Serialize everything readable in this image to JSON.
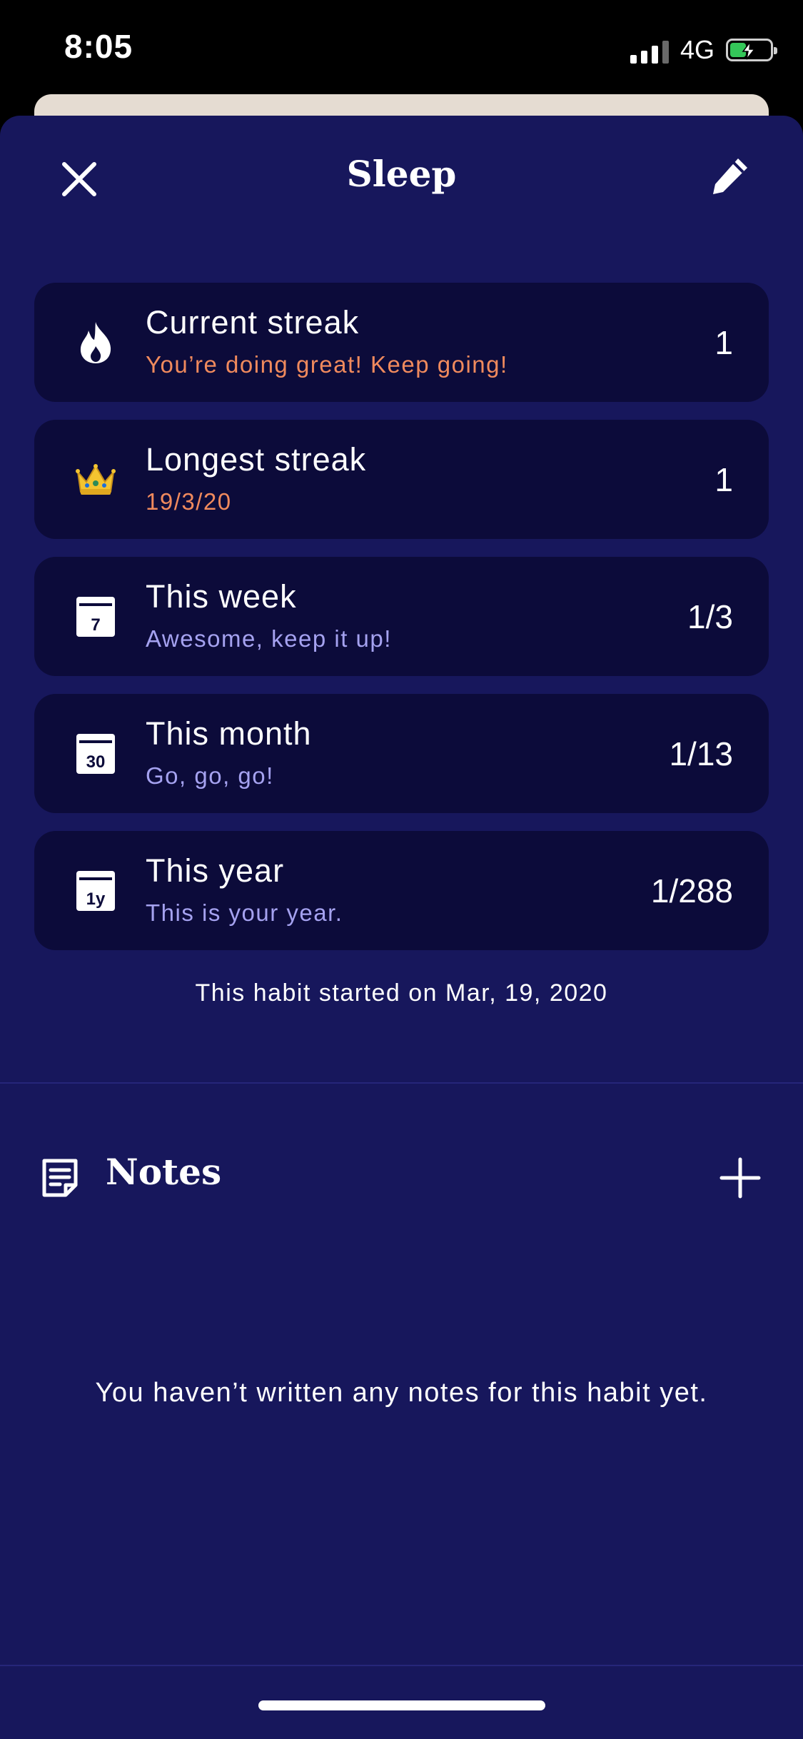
{
  "status_bar": {
    "time": "8:05",
    "network": "4G",
    "battery_color": "#34c759"
  },
  "header": {
    "title": "Sleep",
    "close_icon": "close-icon",
    "edit_icon": "pencil-icon"
  },
  "stats": [
    {
      "icon": "flame-icon",
      "title": "Current streak",
      "subtitle": "You’re doing great! Keep going!",
      "value": "1",
      "subtitle_color": "#f08a5d"
    },
    {
      "icon": "crown-icon",
      "title": "Longest streak",
      "subtitle": "19/3/20",
      "value": "1",
      "subtitle_color": "#f08a5d"
    },
    {
      "icon": "calendar-7-icon",
      "title": "This week",
      "subtitle": "Awesome, keep it up!",
      "value": "1/3",
      "subtitle_color": "#a5a2f0",
      "icon_text": "7"
    },
    {
      "icon": "calendar-30-icon",
      "title": "This month",
      "subtitle": "Go, go, go!",
      "value": "1/13",
      "subtitle_color": "#a5a2f0",
      "icon_text": "30"
    },
    {
      "icon": "calendar-1y-icon",
      "title": "This year",
      "subtitle": "This is your year.",
      "value": "1/288",
      "subtitle_color": "#a5a2f0",
      "icon_text": "1y"
    }
  ],
  "started_note": "This habit started on Mar, 19, 2020",
  "notes": {
    "title": "Notes",
    "empty_message": "You haven’t written any notes for this habit yet."
  },
  "colors": {
    "sheet_background": "#17175c",
    "card_background": "#0c0b3a",
    "peek_card": "#e5dcd2"
  }
}
